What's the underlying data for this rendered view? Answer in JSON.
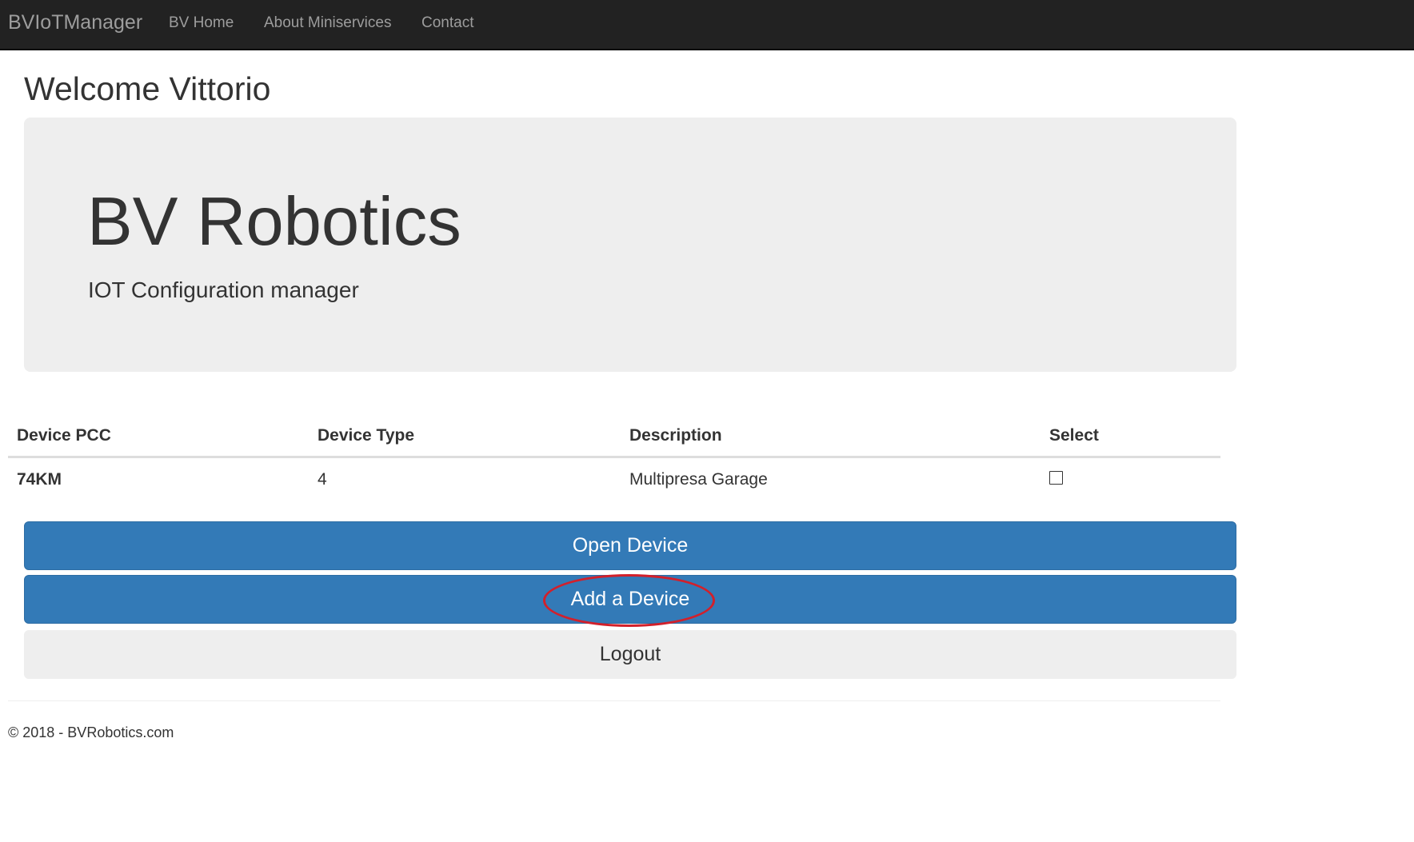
{
  "navbar": {
    "brand": "BVIoTManager",
    "links": [
      "BV Home",
      "About Miniservices",
      "Contact"
    ]
  },
  "welcome": "Welcome Vittorio",
  "jumbotron": {
    "title": "BV Robotics",
    "subtitle": "IOT Configuration manager"
  },
  "table": {
    "headers": [
      "Device PCC",
      "Device Type",
      "Description",
      "Select"
    ],
    "rows": [
      {
        "pcc": "74KM",
        "type": "4",
        "description": "Multipresa Garage",
        "selected": false
      }
    ]
  },
  "buttons": {
    "open": "Open Device",
    "add": "Add a Device",
    "logout": "Logout"
  },
  "highlight_color": "#d2202b",
  "colors": {
    "primary": "#337ab7",
    "navbar": "#222222",
    "jumbotron": "#eeeeee"
  },
  "footer": "© 2018 - BVRobotics.com"
}
